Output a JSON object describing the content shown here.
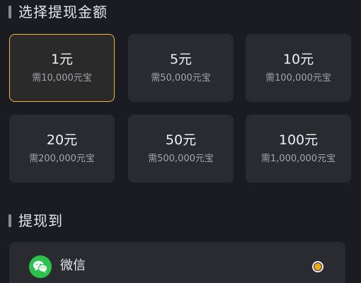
{
  "section_amount": {
    "title": "选择提现金额"
  },
  "amount_options": [
    {
      "amount": "1元",
      "requirement": "需10,000元宝",
      "selected": true
    },
    {
      "amount": "5元",
      "requirement": "需50,000元宝",
      "selected": false
    },
    {
      "amount": "10元",
      "requirement": "需100,000元宝",
      "selected": false
    },
    {
      "amount": "20元",
      "requirement": "需200,000元宝",
      "selected": false
    },
    {
      "amount": "50元",
      "requirement": "需500,000元宝",
      "selected": false
    },
    {
      "amount": "100元",
      "requirement": "需1,000,000元宝",
      "selected": false
    }
  ],
  "section_withdraw_to": {
    "title": "提现到"
  },
  "payment_method": {
    "label": "微信",
    "icon": "wechat-icon",
    "selected": true
  },
  "colors": {
    "background": "#1b1b22",
    "card": "#2a2a31",
    "accent": "#e9b73a",
    "wechat_green": "#2dc24e",
    "radio_fill": "#e9a916"
  }
}
